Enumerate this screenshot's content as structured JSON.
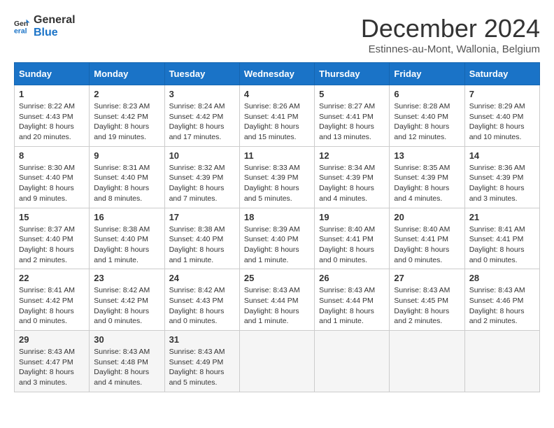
{
  "header": {
    "logo_line1": "General",
    "logo_line2": "Blue",
    "month_title": "December 2024",
    "location": "Estinnes-au-Mont, Wallonia, Belgium"
  },
  "days_of_week": [
    "Sunday",
    "Monday",
    "Tuesday",
    "Wednesday",
    "Thursday",
    "Friday",
    "Saturday"
  ],
  "weeks": [
    [
      {
        "day": "1",
        "sunrise": "8:22 AM",
        "sunset": "4:43 PM",
        "daylight": "8 hours and 20 minutes."
      },
      {
        "day": "2",
        "sunrise": "8:23 AM",
        "sunset": "4:42 PM",
        "daylight": "8 hours and 19 minutes."
      },
      {
        "day": "3",
        "sunrise": "8:24 AM",
        "sunset": "4:42 PM",
        "daylight": "8 hours and 17 minutes."
      },
      {
        "day": "4",
        "sunrise": "8:26 AM",
        "sunset": "4:41 PM",
        "daylight": "8 hours and 15 minutes."
      },
      {
        "day": "5",
        "sunrise": "8:27 AM",
        "sunset": "4:41 PM",
        "daylight": "8 hours and 13 minutes."
      },
      {
        "day": "6",
        "sunrise": "8:28 AM",
        "sunset": "4:40 PM",
        "daylight": "8 hours and 12 minutes."
      },
      {
        "day": "7",
        "sunrise": "8:29 AM",
        "sunset": "4:40 PM",
        "daylight": "8 hours and 10 minutes."
      }
    ],
    [
      {
        "day": "8",
        "sunrise": "8:30 AM",
        "sunset": "4:40 PM",
        "daylight": "8 hours and 9 minutes."
      },
      {
        "day": "9",
        "sunrise": "8:31 AM",
        "sunset": "4:40 PM",
        "daylight": "8 hours and 8 minutes."
      },
      {
        "day": "10",
        "sunrise": "8:32 AM",
        "sunset": "4:39 PM",
        "daylight": "8 hours and 7 minutes."
      },
      {
        "day": "11",
        "sunrise": "8:33 AM",
        "sunset": "4:39 PM",
        "daylight": "8 hours and 5 minutes."
      },
      {
        "day": "12",
        "sunrise": "8:34 AM",
        "sunset": "4:39 PM",
        "daylight": "8 hours and 4 minutes."
      },
      {
        "day": "13",
        "sunrise": "8:35 AM",
        "sunset": "4:39 PM",
        "daylight": "8 hours and 4 minutes."
      },
      {
        "day": "14",
        "sunrise": "8:36 AM",
        "sunset": "4:39 PM",
        "daylight": "8 hours and 3 minutes."
      }
    ],
    [
      {
        "day": "15",
        "sunrise": "8:37 AM",
        "sunset": "4:40 PM",
        "daylight": "8 hours and 2 minutes."
      },
      {
        "day": "16",
        "sunrise": "8:38 AM",
        "sunset": "4:40 PM",
        "daylight": "8 hours and 1 minute."
      },
      {
        "day": "17",
        "sunrise": "8:38 AM",
        "sunset": "4:40 PM",
        "daylight": "8 hours and 1 minute."
      },
      {
        "day": "18",
        "sunrise": "8:39 AM",
        "sunset": "4:40 PM",
        "daylight": "8 hours and 1 minute."
      },
      {
        "day": "19",
        "sunrise": "8:40 AM",
        "sunset": "4:41 PM",
        "daylight": "8 hours and 0 minutes."
      },
      {
        "day": "20",
        "sunrise": "8:40 AM",
        "sunset": "4:41 PM",
        "daylight": "8 hours and 0 minutes."
      },
      {
        "day": "21",
        "sunrise": "8:41 AM",
        "sunset": "4:41 PM",
        "daylight": "8 hours and 0 minutes."
      }
    ],
    [
      {
        "day": "22",
        "sunrise": "8:41 AM",
        "sunset": "4:42 PM",
        "daylight": "8 hours and 0 minutes."
      },
      {
        "day": "23",
        "sunrise": "8:42 AM",
        "sunset": "4:42 PM",
        "daylight": "8 hours and 0 minutes."
      },
      {
        "day": "24",
        "sunrise": "8:42 AM",
        "sunset": "4:43 PM",
        "daylight": "8 hours and 0 minutes."
      },
      {
        "day": "25",
        "sunrise": "8:43 AM",
        "sunset": "4:44 PM",
        "daylight": "8 hours and 1 minute."
      },
      {
        "day": "26",
        "sunrise": "8:43 AM",
        "sunset": "4:44 PM",
        "daylight": "8 hours and 1 minute."
      },
      {
        "day": "27",
        "sunrise": "8:43 AM",
        "sunset": "4:45 PM",
        "daylight": "8 hours and 2 minutes."
      },
      {
        "day": "28",
        "sunrise": "8:43 AM",
        "sunset": "4:46 PM",
        "daylight": "8 hours and 2 minutes."
      }
    ],
    [
      {
        "day": "29",
        "sunrise": "8:43 AM",
        "sunset": "4:47 PM",
        "daylight": "8 hours and 3 minutes."
      },
      {
        "day": "30",
        "sunrise": "8:43 AM",
        "sunset": "4:48 PM",
        "daylight": "8 hours and 4 minutes."
      },
      {
        "day": "31",
        "sunrise": "8:43 AM",
        "sunset": "4:49 PM",
        "daylight": "8 hours and 5 minutes."
      },
      null,
      null,
      null,
      null
    ]
  ],
  "labels": {
    "sunrise": "Sunrise:",
    "sunset": "Sunset:",
    "daylight": "Daylight:"
  }
}
